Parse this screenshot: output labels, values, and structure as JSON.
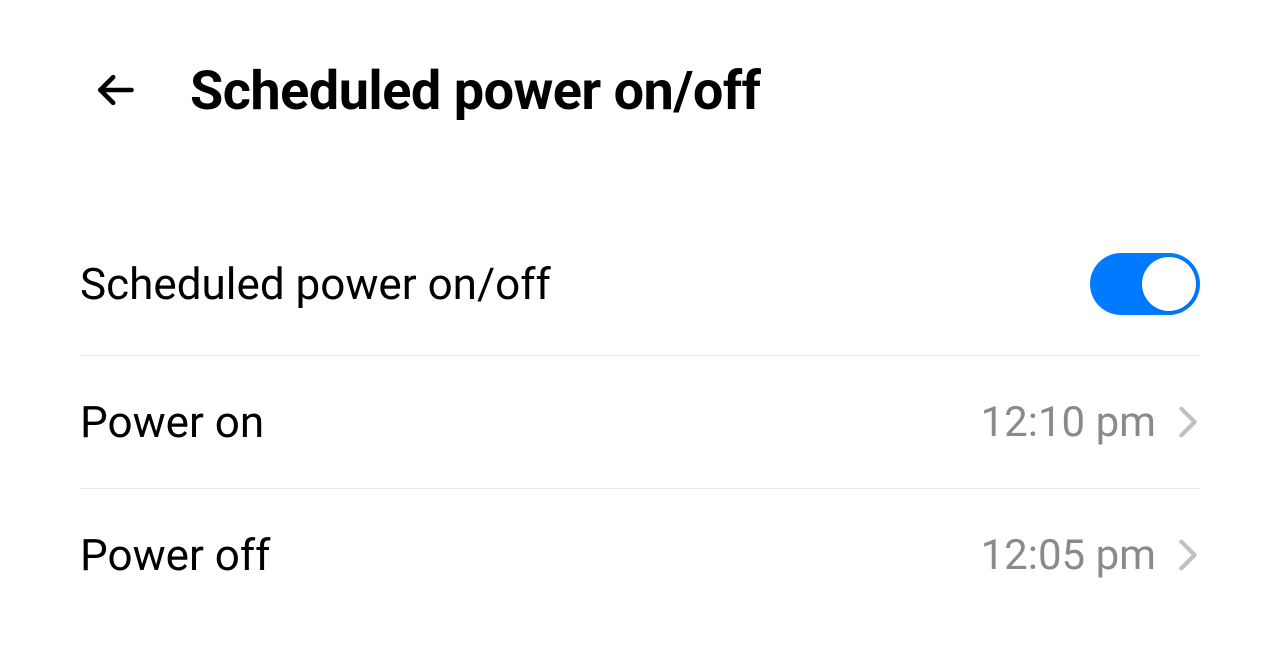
{
  "header": {
    "title": "Scheduled power on/off"
  },
  "settings": {
    "master_toggle": {
      "label": "Scheduled power on/off",
      "enabled": true
    },
    "power_on": {
      "label": "Power on",
      "value": "12:10 pm"
    },
    "power_off": {
      "label": "Power off",
      "value": "12:05 pm"
    }
  },
  "colors": {
    "accent": "#007aff",
    "text_primary": "#000000",
    "text_secondary": "#8a8a8a",
    "divider": "#e8e8e8"
  }
}
